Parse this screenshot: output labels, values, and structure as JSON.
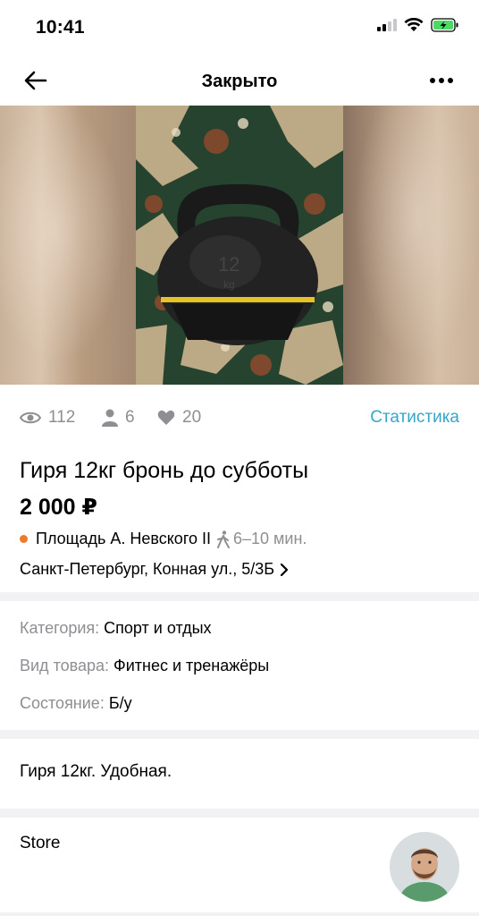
{
  "status_bar": {
    "time": "10:41",
    "icons": [
      "signal-icon",
      "wifi-icon",
      "battery-charging-icon"
    ],
    "battery_color": "#4cd964"
  },
  "nav": {
    "title": "Закрыто",
    "back_icon": "arrow-left-icon",
    "more_icon": "more-icon"
  },
  "stats": {
    "views": "112",
    "contacts": "6",
    "favorites": "20",
    "link_label": "Статистика",
    "link_color": "#34a7c9"
  },
  "listing": {
    "title": "Гиря 12кг бронь до субботы",
    "price": "2 000 ₽",
    "metro": {
      "station": "Площадь А. Невского II",
      "walk_time": "6–10 мин.",
      "line_color": "#f07a2c"
    },
    "address": "Санкт-Петербург, Конная ул., 5/3Б"
  },
  "params": [
    {
      "label": "Категория:",
      "value": "Спорт и отдых"
    },
    {
      "label": "Вид товара:",
      "value": "Фитнес и тренажёры"
    },
    {
      "label": "Состояние:",
      "value": "Б/у"
    }
  ],
  "description": "Гиря 12кг. Удобная.",
  "seller": {
    "name": "Store"
  }
}
